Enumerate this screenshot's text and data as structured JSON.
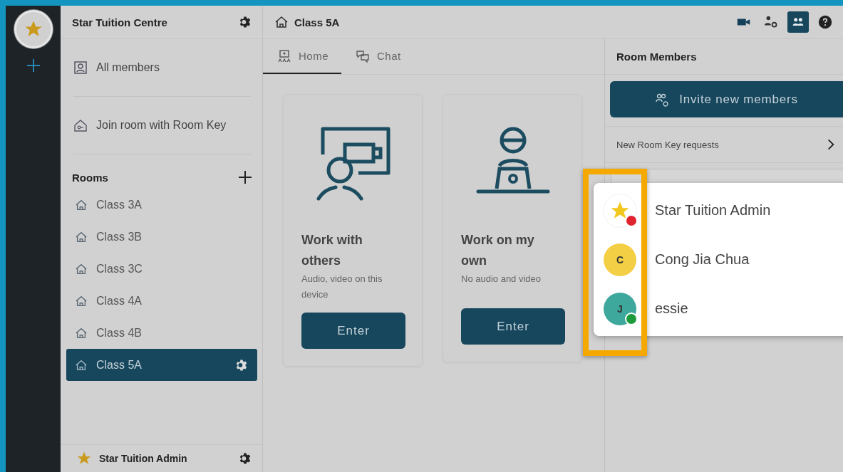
{
  "workspace": {
    "name": "Star Tuition Centre"
  },
  "sidebar": {
    "links": [
      {
        "kind": "members",
        "label": "All members"
      },
      {
        "kind": "key",
        "label": "Join room with Room Key"
      }
    ],
    "rooms_heading": "Rooms",
    "rooms": [
      {
        "label": "Class 3A",
        "selected": false
      },
      {
        "label": "Class 3B",
        "selected": false
      },
      {
        "label": "Class 3C",
        "selected": false
      },
      {
        "label": "Class 4A",
        "selected": false
      },
      {
        "label": "Class 4B",
        "selected": false
      },
      {
        "label": "Class 5A",
        "selected": true
      }
    ],
    "user": {
      "name": "Star Tuition Admin"
    }
  },
  "room": {
    "title": "Class 5A"
  },
  "toolbar": [
    {
      "kind": "camera",
      "selected": false
    },
    {
      "kind": "person-settings",
      "selected": false
    },
    {
      "kind": "members",
      "selected": true
    },
    {
      "kind": "help",
      "selected": false
    }
  ],
  "tabs": [
    {
      "kind": "home",
      "label": "Home",
      "selected": true
    },
    {
      "kind": "chat",
      "label": "Chat",
      "selected": false
    }
  ],
  "cards": [
    {
      "kind": "together",
      "title": "Work with others",
      "subtitle": "Audio, video on this device",
      "button": "Enter"
    },
    {
      "kind": "alone",
      "title": "Work on my own",
      "subtitle": "No audio and video",
      "button": "Enter"
    }
  ],
  "members_panel": {
    "title": "Room Members",
    "invite_button": "Invite new members",
    "requests": "New Room Key requests"
  },
  "popup": {
    "members": [
      {
        "name": "Star Tuition Admin",
        "avatar": {
          "kind": "star"
        },
        "status": {
          "color": "#e0232e"
        }
      },
      {
        "name": "Cong Jia Chua",
        "avatar": {
          "kind": "initial",
          "initial": "C",
          "color": "#f3cf45"
        }
      },
      {
        "name": "essie",
        "avatar": {
          "kind": "initial",
          "initial": "J",
          "color": "#3ea89d"
        },
        "status": {
          "color": "#1c9a3c"
        }
      }
    ]
  }
}
